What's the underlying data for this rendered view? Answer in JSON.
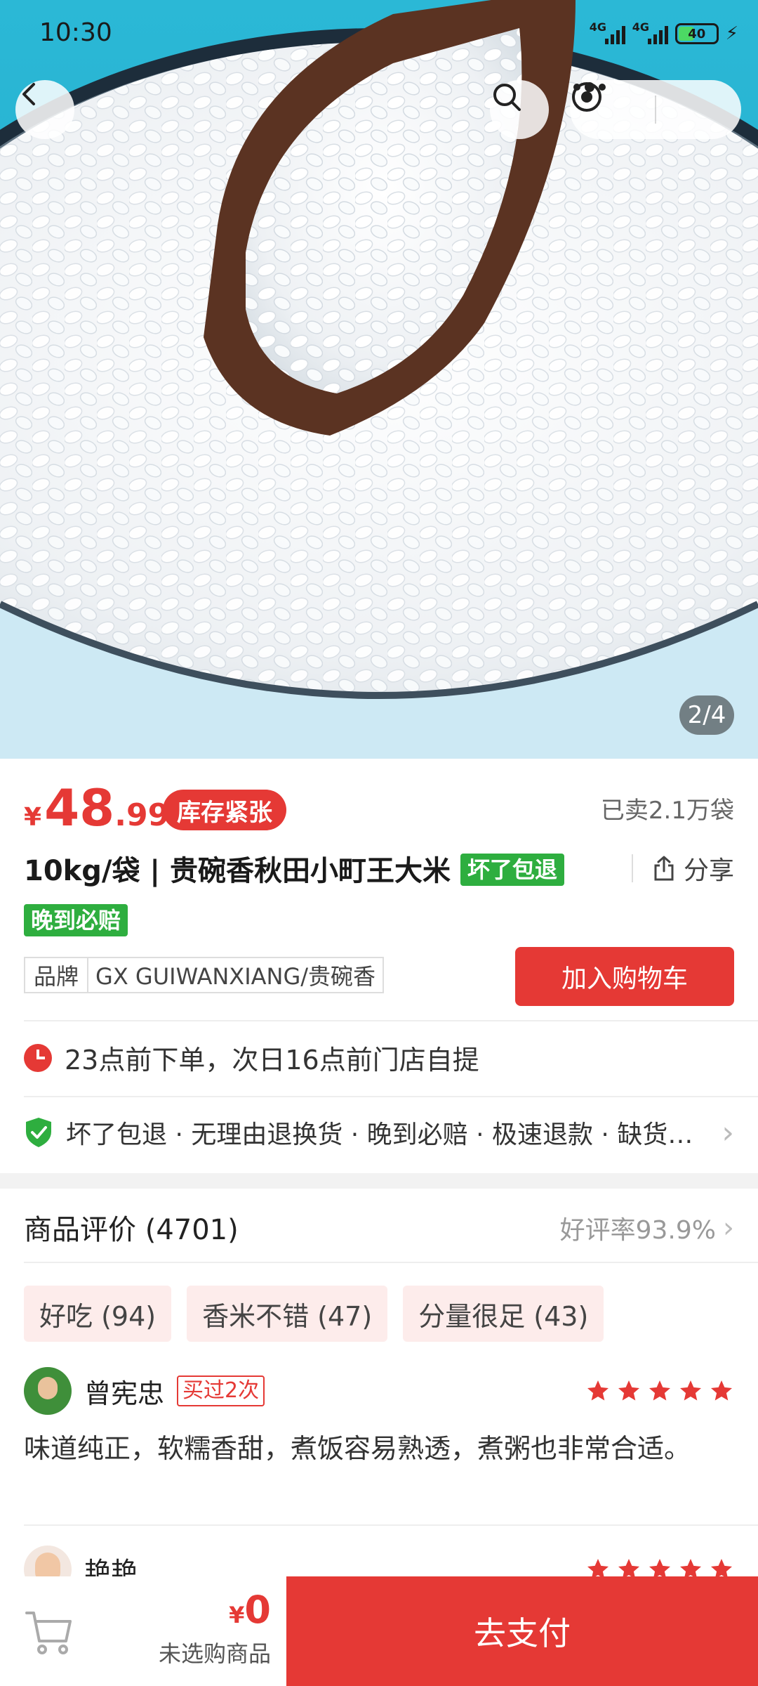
{
  "status_bar": {
    "time": "10:30",
    "network1": "4G",
    "network2": "4G",
    "battery": "40"
  },
  "gallery": {
    "page_indicator": "2/4"
  },
  "product": {
    "price_symbol": "¥",
    "price_integer": "48",
    "price_decimal": ".99",
    "stock_badge": "库存紧张",
    "sold": "已卖2.1万袋",
    "title": "10kg/袋 | 贵碗香秋田小町王大米",
    "tags": [
      "坏了包退",
      "晚到必赔"
    ],
    "share_label": "分享",
    "brand_key": "品牌",
    "brand_value": "GX GUIWANXIANG/贵碗香",
    "add_to_cart": "加入购物车",
    "pickup": "23点前下单，次日16点前门店自提",
    "guarantee": "坏了包退 · 无理由退换货 · 晚到必赔 · 极速退款 · 缺货必赔"
  },
  "reviews": {
    "header": "商品评价 (4701)",
    "rating": "好评率93.9%",
    "chips": [
      "好吃 (94)",
      "香米不错 (47)",
      "分量很足 (43)"
    ],
    "items": [
      {
        "name": "曾宪忠",
        "badge": "买过2次",
        "stars": 5,
        "text": "味道纯正，软糯香甜，煮饭容易熟透，煮粥也非常合适。"
      },
      {
        "name": "艳艳",
        "stars": 5
      }
    ]
  },
  "bottom_bar": {
    "currency": "¥",
    "total": "0",
    "note": "未选购商品",
    "pay_label": "去支付"
  },
  "colors": {
    "accent": "#e53935",
    "tag_green": "#2eae3f",
    "chip_bg": "#fdeceb"
  }
}
